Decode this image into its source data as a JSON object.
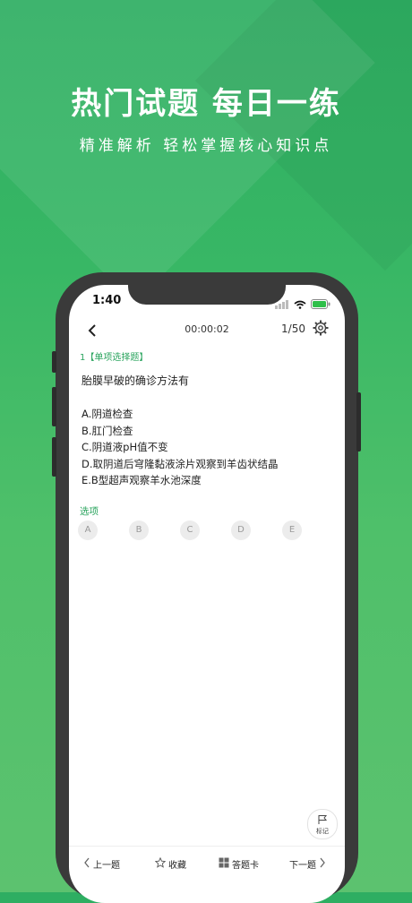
{
  "promo": {
    "headline": "热门试题 每日一练",
    "subline": "精准解析 轻松掌握核心知识点"
  },
  "status_bar": {
    "time": "1:40"
  },
  "quiz_header": {
    "timer": "00:00:02",
    "progress": "1/50"
  },
  "question": {
    "type_label": "1【单项选择题】",
    "text": "胎膜早破的确诊方法有",
    "options": [
      "A.阴道检查",
      "B.肛门检查",
      "C.阴道液pH值不变",
      "D.取阴道后穹隆黏液涂片观察到羊齿状结晶",
      "E.B型超声观察羊水池深度"
    ]
  },
  "answer": {
    "section_label": "选项",
    "choices": [
      "A",
      "B",
      "C",
      "D",
      "E"
    ]
  },
  "mark_button": {
    "label": "标记"
  },
  "bottom_bar": {
    "prev": "上一题",
    "favorite": "收藏",
    "answer_card": "答题卡",
    "next": "下一题"
  },
  "colors": {
    "accent": "#2aa45e",
    "background_top": "#2eae62",
    "background_bottom": "#5cc26f"
  }
}
